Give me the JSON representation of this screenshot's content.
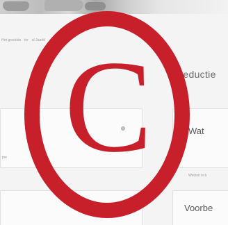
{
  "breadcrumb": [
    "Het grootste",
    "ter",
    "al Jaarkl"
  ],
  "section_heading": "Deductie",
  "cards": [
    {
      "title": "Wat",
      "sub": "Wetzen in b"
    },
    {
      "title": "Voorbe",
      "sub": ""
    }
  ],
  "left_card_sub": "per",
  "watermark": {
    "symbol": "C",
    "icon": "copyright-icon",
    "color": "#c8202b"
  }
}
